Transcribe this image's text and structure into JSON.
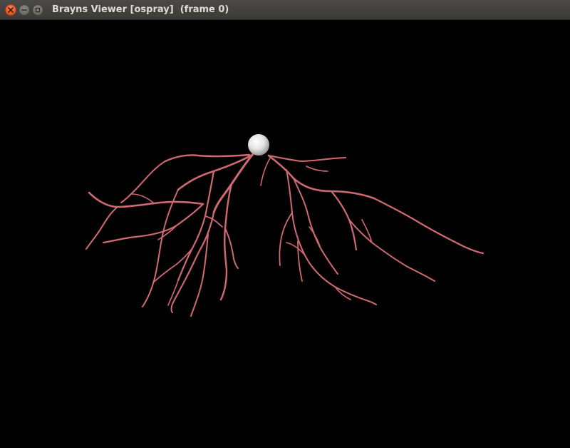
{
  "window": {
    "title": "Brayns Viewer [ospray]  (frame 0)",
    "buttons": [
      "close-icon",
      "minimize-icon",
      "maximize-icon"
    ]
  },
  "colors": {
    "titlebar": "#3c3b37",
    "close_button": "#e1541f",
    "background": "#000000",
    "dendrite": "#d06a70",
    "soma": "#e8e8e8"
  },
  "viewport": {
    "scene": "neuron morphology render",
    "parts": [
      "soma-sphere",
      "dendrites"
    ]
  }
}
